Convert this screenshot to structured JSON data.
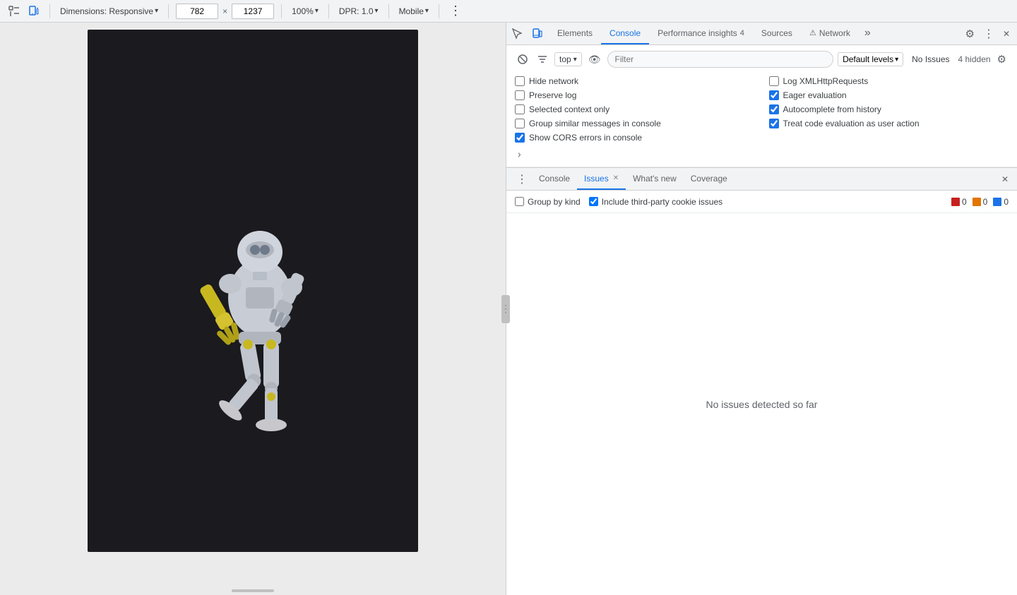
{
  "toolbar": {
    "dimensions_label": "Dimensions: Responsive",
    "width_value": "782",
    "height_value": "1237",
    "zoom_label": "100%",
    "dpr_label": "DPR: 1.0",
    "mobile_label": "Mobile"
  },
  "devtools_tabs": [
    {
      "id": "elements",
      "label": "Elements",
      "active": false
    },
    {
      "id": "console",
      "label": "Console",
      "active": true
    },
    {
      "id": "performance_insights",
      "label": "Performance insights",
      "badge": "4",
      "active": false
    },
    {
      "id": "sources",
      "label": "Sources",
      "active": false
    },
    {
      "id": "network",
      "label": "Network",
      "has_warning": true,
      "active": false
    }
  ],
  "console_toolbar": {
    "context_label": "top",
    "filter_placeholder": "Filter",
    "levels_label": "Default levels",
    "no_issues_label": "No Issues",
    "hidden_label": "4 hidden"
  },
  "checkboxes": {
    "left": [
      {
        "id": "hide_network",
        "label": "Hide network",
        "checked": false
      },
      {
        "id": "preserve_log",
        "label": "Preserve log",
        "checked": false
      },
      {
        "id": "selected_context",
        "label": "Selected context only",
        "checked": false
      },
      {
        "id": "group_similar",
        "label": "Group similar messages in console",
        "checked": false
      },
      {
        "id": "show_cors",
        "label": "Show CORS errors in console",
        "checked": true
      }
    ],
    "right": [
      {
        "id": "log_xml",
        "label": "Log XMLHttpRequests",
        "checked": false
      },
      {
        "id": "eager_eval",
        "label": "Eager evaluation",
        "checked": true
      },
      {
        "id": "autocomplete",
        "label": "Autocomplete from history",
        "checked": true
      },
      {
        "id": "treat_code",
        "label": "Treat code evaluation as user action",
        "checked": true
      }
    ]
  },
  "bottom_tabs": [
    {
      "id": "console",
      "label": "Console",
      "active": false,
      "closeable": false
    },
    {
      "id": "issues",
      "label": "Issues",
      "active": true,
      "closeable": true
    },
    {
      "id": "whats_new",
      "label": "What's new",
      "active": false,
      "closeable": false
    },
    {
      "id": "coverage",
      "label": "Coverage",
      "active": false,
      "closeable": false
    }
  ],
  "issues_toolbar": {
    "group_by_kind_label": "Group by kind",
    "third_party_label": "Include third-party cookie issues",
    "red_count": "0",
    "orange_count": "0",
    "blue_count": "0"
  },
  "issues_content": {
    "empty_message": "No issues detected so far"
  }
}
